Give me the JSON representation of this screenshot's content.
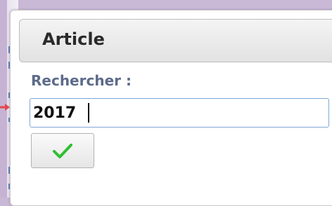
{
  "dialog": {
    "title": "Article",
    "search_label": "Rechercher :",
    "search_value": "2017"
  },
  "icons": {
    "validate": "check-icon",
    "pointer": "arrow-right-icon"
  },
  "colors": {
    "check": "#2fbf2f",
    "pointer": "#e0474c",
    "label": "#5d6b8a",
    "input_border": "#7fa7d9"
  }
}
